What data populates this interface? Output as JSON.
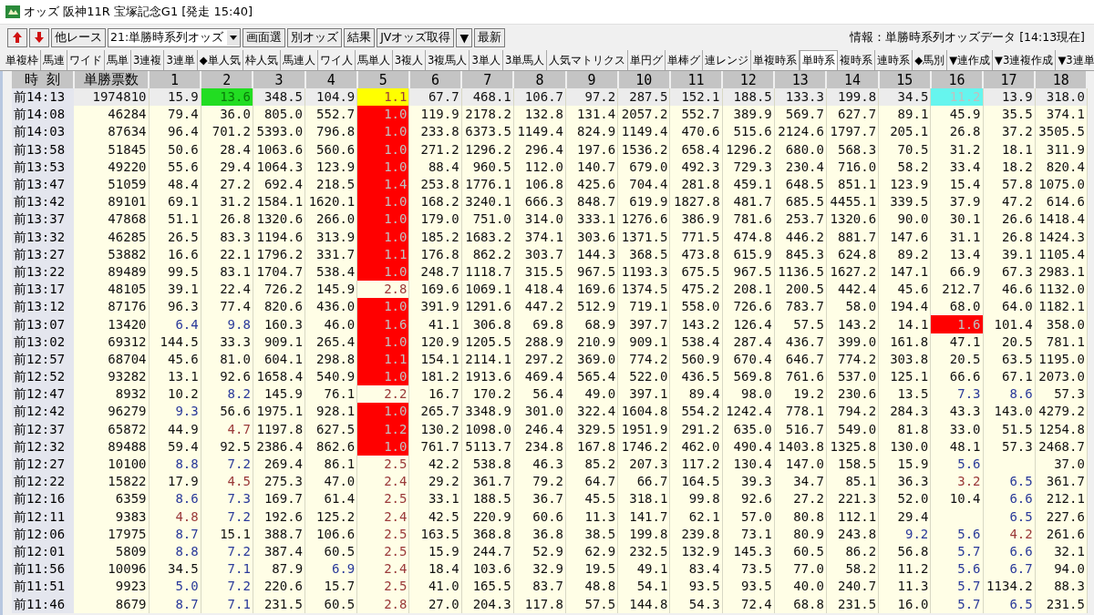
{
  "window": {
    "title": "オッズ 阪神11R 宝塚記念G1 [発走 15:40]"
  },
  "toolbar": {
    "buttons": [
      {
        "kind": "up"
      },
      {
        "kind": "down"
      },
      {
        "kind": "text",
        "label": "他レース"
      }
    ],
    "select": "21:単勝時系列オッズ",
    "actions": [
      "画面選",
      "別オッズ",
      "結果",
      "JVオッズ取得",
      "▼",
      "最新"
    ],
    "info": "情報：単勝時系列オッズデータ [14:13現在]"
  },
  "tabs": [
    {
      "label": "単複枠",
      "selected": false
    },
    {
      "label": "馬連",
      "selected": false
    },
    {
      "label": "ワイド",
      "selected": false
    },
    {
      "label": "馬単",
      "selected": false
    },
    {
      "label": "3連複",
      "selected": false
    },
    {
      "label": "3連単",
      "selected": false
    },
    {
      "label": "◆単人気",
      "selected": false
    },
    {
      "label": "枠人気",
      "selected": false
    },
    {
      "label": "馬連人",
      "selected": false
    },
    {
      "label": "ワイ人",
      "selected": false
    },
    {
      "label": "馬単人",
      "selected": false
    },
    {
      "label": "3複人",
      "selected": false
    },
    {
      "label": "3複馬人",
      "selected": false
    },
    {
      "label": "3単人",
      "selected": false
    },
    {
      "label": "3単馬人",
      "selected": false
    },
    {
      "label": "人気マトリクス",
      "selected": false
    },
    {
      "label": "単円グ",
      "selected": false
    },
    {
      "label": "単棒グ",
      "selected": false
    },
    {
      "label": "連レンジ",
      "selected": false
    },
    {
      "label": "単複時系",
      "selected": false
    },
    {
      "label": "単時系",
      "selected": true
    },
    {
      "label": "複時系",
      "selected": false
    },
    {
      "label": "連時系",
      "selected": false
    },
    {
      "label": "◆馬別",
      "selected": false
    },
    {
      "label": "▼連作成",
      "selected": false
    },
    {
      "label": "▼3連複作成",
      "selected": false
    },
    {
      "label": "▼3連単",
      "selected": false
    }
  ],
  "table": {
    "columns": [
      "時 刻",
      "単勝票数",
      "1",
      "2",
      "3",
      "4",
      "5",
      "6",
      "7",
      "8",
      "9",
      "10",
      "11",
      "12",
      "13",
      "14",
      "15",
      "16",
      "17",
      "18"
    ],
    "rows": [
      {
        "time": "前14:13",
        "votes": "1974810",
        "current": true,
        "odds": [
          "15.9",
          {
            "text": "13.6",
            "color": "#22dd22",
            "kind": "green"
          },
          "348.5",
          "104.9",
          {
            "text": "1.1",
            "color": "#ffff00",
            "kind": "brown"
          },
          "67.7",
          "468.1",
          "106.7",
          "97.2",
          "287.5",
          "152.1",
          "188.5",
          "133.3",
          "199.8",
          "34.5",
          {
            "text": "11.2",
            "color": "#66f5ee",
            "kind": "grey"
          },
          "13.9",
          "318.0"
        ]
      },
      {
        "time": "前14:08",
        "votes": "46284",
        "current": false,
        "odds": [
          "79.4",
          "36.0",
          "805.0",
          "552.7",
          {
            "text": "1.0",
            "color": "#ff0000",
            "kind": "grey"
          },
          "119.9",
          "2178.2",
          "132.8",
          "131.4",
          "2057.2",
          "552.7",
          "389.9",
          "569.7",
          "627.7",
          "89.1",
          "45.9",
          "35.5",
          "374.1"
        ]
      },
      {
        "time": "前14:03",
        "votes": "87634",
        "current": false,
        "odds": [
          "96.4",
          "701.2",
          "5393.0",
          "796.8",
          {
            "text": "1.0",
            "color": "#ff0000",
            "kind": "grey"
          },
          "233.8",
          "6373.5",
          "1149.4",
          "824.9",
          "1149.4",
          "470.6",
          "515.6",
          "2124.6",
          "1797.7",
          "205.1",
          "26.8",
          "37.2",
          "3505.5"
        ]
      },
      {
        "time": "前13:58",
        "votes": "51845",
        "current": false,
        "odds": [
          "50.6",
          "28.4",
          "1063.6",
          "560.6",
          {
            "text": "1.0",
            "color": "#ff0000",
            "kind": "grey"
          },
          "271.2",
          "1296.2",
          "296.4",
          "197.6",
          "1536.2",
          "658.4",
          "1296.2",
          "680.0",
          "568.3",
          "70.5",
          "31.2",
          "18.1",
          "311.9"
        ]
      },
      {
        "time": "前13:53",
        "votes": "49220",
        "current": false,
        "odds": [
          "55.6",
          "29.4",
          "1064.3",
          "123.9",
          {
            "text": "1.0",
            "color": "#ff0000",
            "kind": "grey"
          },
          "88.4",
          "960.5",
          "112.0",
          "140.7",
          "679.0",
          "492.3",
          "729.3",
          "230.4",
          "716.0",
          "58.2",
          "33.4",
          "18.2",
          "820.4"
        ]
      },
      {
        "time": "前13:47",
        "votes": "51059",
        "current": false,
        "odds": [
          "48.4",
          "27.2",
          "692.4",
          "218.5",
          {
            "text": "1.4",
            "color": "#ff0000",
            "kind": "grey"
          },
          "253.8",
          "1776.1",
          "106.8",
          "425.6",
          "704.4",
          "281.8",
          "459.1",
          "648.5",
          "851.1",
          "123.9",
          "15.4",
          "57.8",
          "1075.0"
        ]
      },
      {
        "time": "前13:42",
        "votes": "89101",
        "current": false,
        "odds": [
          "69.1",
          "31.2",
          "1584.1",
          "1620.1",
          {
            "text": "1.0",
            "color": "#ff0000",
            "kind": "grey"
          },
          "168.2",
          "3240.1",
          "666.3",
          "848.7",
          "619.9",
          "1827.8",
          "481.7",
          "685.5",
          "4455.1",
          "339.5",
          "37.9",
          "47.2",
          "614.6"
        ]
      },
      {
        "time": "前13:37",
        "votes": "47868",
        "current": false,
        "odds": [
          "51.1",
          "26.8",
          "1320.6",
          "266.0",
          {
            "text": "1.0",
            "color": "#ff0000",
            "kind": "grey"
          },
          "179.0",
          "751.0",
          "314.0",
          "333.1",
          "1276.6",
          "386.9",
          "781.6",
          "253.7",
          "1320.6",
          "90.0",
          "30.1",
          "26.6",
          "1418.4"
        ]
      },
      {
        "time": "前13:32",
        "votes": "46285",
        "current": false,
        "odds": [
          "26.5",
          "83.3",
          "1194.6",
          "313.9",
          {
            "text": "1.0",
            "color": "#ff0000",
            "kind": "grey"
          },
          "185.2",
          "1683.2",
          "374.1",
          "303.6",
          "1371.5",
          "771.5",
          "474.8",
          "446.2",
          "881.7",
          "147.6",
          "31.1",
          "26.8",
          "1424.3"
        ]
      },
      {
        "time": "前13:27",
        "votes": "53882",
        "current": false,
        "odds": [
          "16.6",
          "22.1",
          "1796.2",
          "331.7",
          {
            "text": "1.1",
            "color": "#ff0000",
            "kind": "grey"
          },
          "176.8",
          "862.2",
          "303.7",
          "144.3",
          "368.5",
          "473.8",
          "615.9",
          "845.3",
          "624.8",
          "89.2",
          "13.4",
          "39.1",
          "1105.4"
        ]
      },
      {
        "time": "前13:22",
        "votes": "89489",
        "current": false,
        "odds": [
          "99.5",
          "83.1",
          "1704.7",
          "538.4",
          {
            "text": "1.0",
            "color": "#ff0000",
            "kind": "grey"
          },
          "248.7",
          "1118.7",
          "315.5",
          "967.5",
          "1193.3",
          "675.5",
          "967.5",
          "1136.5",
          "1627.2",
          "147.1",
          "66.9",
          "67.3",
          "2983.1"
        ]
      },
      {
        "time": "前13:17",
        "votes": "48105",
        "current": false,
        "odds": [
          "39.1",
          "22.4",
          "726.2",
          "145.9",
          {
            "text": "2.8",
            "kind": "brown"
          },
          "169.6",
          "1069.1",
          "418.4",
          "169.6",
          "1374.5",
          "475.2",
          "208.1",
          "200.5",
          "442.4",
          "45.6",
          "212.7",
          "46.6",
          "1132.0"
        ]
      },
      {
        "time": "前13:12",
        "votes": "87176",
        "current": false,
        "odds": [
          "96.3",
          "77.4",
          "820.6",
          "436.0",
          {
            "text": "1.0",
            "color": "#ff0000",
            "kind": "grey"
          },
          "391.9",
          "1291.6",
          "447.2",
          "512.9",
          "719.1",
          "558.0",
          "726.6",
          "783.7",
          "58.0",
          "194.4",
          "68.0",
          "64.0",
          "1182.1"
        ]
      },
      {
        "time": "前13:07",
        "votes": "13420",
        "current": false,
        "odds": [
          {
            "text": "6.4",
            "kind": "navy"
          },
          {
            "text": "9.8",
            "kind": "navy"
          },
          "160.3",
          "46.0",
          {
            "text": "1.6",
            "color": "#ff0000",
            "kind": "grey"
          },
          "41.1",
          "306.8",
          "69.8",
          "68.9",
          "397.7",
          "143.2",
          "126.4",
          "57.5",
          "143.2",
          "14.1",
          {
            "text": "1.6",
            "color": "#ff0000",
            "kind": "grey"
          },
          "101.4",
          "358.0"
        ]
      },
      {
        "time": "前13:02",
        "votes": "69312",
        "current": false,
        "odds": [
          "144.5",
          "33.3",
          "909.1",
          "265.4",
          {
            "text": "1.0",
            "color": "#ff0000",
            "kind": "grey"
          },
          "120.9",
          "1205.5",
          "288.9",
          "210.9",
          "909.1",
          "538.4",
          "287.4",
          "436.7",
          "399.0",
          "161.8",
          "47.1",
          "20.5",
          "781.1"
        ]
      },
      {
        "time": "前12:57",
        "votes": "68704",
        "current": false,
        "odds": [
          "45.6",
          "81.0",
          "604.1",
          "298.8",
          {
            "text": "1.1",
            "color": "#ff0000",
            "kind": "grey"
          },
          "154.1",
          "2114.1",
          "297.2",
          "369.0",
          "774.2",
          "560.9",
          "670.4",
          "646.7",
          "774.2",
          "303.8",
          "20.5",
          "63.5",
          "1195.0"
        ]
      },
      {
        "time": "前12:52",
        "votes": "93282",
        "current": false,
        "odds": [
          "13.1",
          "92.6",
          "1658.4",
          "540.9",
          {
            "text": "1.0",
            "color": "#ff0000",
            "kind": "grey"
          },
          "181.2",
          "1913.6",
          "469.4",
          "565.4",
          "522.0",
          "436.5",
          "569.8",
          "761.6",
          "537.0",
          "125.1",
          "66.6",
          "67.1",
          "2073.0"
        ]
      },
      {
        "time": "前12:47",
        "votes": "8932",
        "current": false,
        "odds": [
          "10.2",
          {
            "text": "8.2",
            "kind": "navy"
          },
          "145.9",
          "76.1",
          {
            "text": "2.2",
            "kind": "brown"
          },
          "16.7",
          "170.2",
          "56.4",
          "49.0",
          "397.1",
          "89.4",
          "98.0",
          "19.2",
          "230.6",
          "13.5",
          {
            "text": "7.3",
            "kind": "navy"
          },
          {
            "text": "8.6",
            "kind": "navy"
          },
          "57.3"
        ]
      },
      {
        "time": "前12:42",
        "votes": "96279",
        "current": false,
        "odds": [
          {
            "text": "9.3",
            "kind": "navy"
          },
          "56.6",
          "1975.1",
          "928.1",
          {
            "text": "1.0",
            "color": "#ff0000",
            "kind": "grey"
          },
          "265.7",
          "3348.9",
          "301.0",
          "322.4",
          "1604.8",
          "554.2",
          "1242.4",
          "778.1",
          "794.2",
          "284.3",
          "43.3",
          "143.0",
          "4279.2"
        ]
      },
      {
        "time": "前12:37",
        "votes": "65872",
        "current": false,
        "odds": [
          "44.9",
          {
            "text": "4.7",
            "kind": "brown"
          },
          "1197.8",
          "627.5",
          {
            "text": "1.2",
            "color": "#ff0000",
            "kind": "grey"
          },
          "130.2",
          "1098.0",
          "246.4",
          "329.5",
          "1951.9",
          "291.2",
          "635.0",
          "516.7",
          "549.0",
          "81.8",
          "33.0",
          "51.5",
          "1254.8"
        ]
      },
      {
        "time": "前12:32",
        "votes": "89488",
        "current": false,
        "odds": [
          "59.4",
          "92.5",
          "2386.4",
          "862.6",
          {
            "text": "1.0",
            "color": "#ff0000",
            "kind": "grey"
          },
          "761.7",
          "5113.7",
          "234.8",
          "167.8",
          "1746.2",
          "462.0",
          "490.4",
          "1403.8",
          "1325.8",
          "130.0",
          "48.1",
          "57.3",
          "2468.7"
        ]
      },
      {
        "time": "前12:27",
        "votes": "10100",
        "current": false,
        "odds": [
          {
            "text": "8.8",
            "kind": "navy"
          },
          {
            "text": "7.2",
            "kind": "navy"
          },
          "269.4",
          "86.1",
          {
            "text": "2.5",
            "kind": "brown"
          },
          "42.2",
          "538.8",
          "46.3",
          "85.2",
          "207.3",
          "117.2",
          "130.4",
          "147.0",
          "158.5",
          "15.9",
          {
            "text": "5.6",
            "kind": "navy"
          },
          {
            "kind": "blank"
          },
          "37.0"
        ]
      },
      {
        "time": "前12:22",
        "votes": "15822",
        "current": false,
        "odds": [
          "17.9",
          {
            "text": "4.5",
            "kind": "brown"
          },
          "275.3",
          "47.0",
          {
            "text": "2.4",
            "kind": "brown"
          },
          "29.2",
          "361.7",
          "79.2",
          "64.7",
          "66.7",
          "164.5",
          "39.3",
          "34.7",
          "85.1",
          "36.3",
          {
            "text": "3.2",
            "kind": "brown"
          },
          {
            "text": "6.5",
            "kind": "navy"
          },
          "361.7"
        ]
      },
      {
        "time": "前12:16",
        "votes": "6359",
        "current": false,
        "odds": [
          {
            "text": "8.6",
            "kind": "navy"
          },
          {
            "text": "7.3",
            "kind": "navy"
          },
          "169.7",
          "61.4",
          {
            "text": "2.5",
            "kind": "brown"
          },
          "33.1",
          "188.5",
          "36.7",
          "45.5",
          "318.1",
          "99.8",
          "92.6",
          "27.2",
          "221.3",
          "52.0",
          "10.4",
          {
            "text": "6.6",
            "kind": "navy"
          },
          "212.1"
        ]
      },
      {
        "time": "前12:11",
        "votes": "9383",
        "current": false,
        "odds": [
          {
            "text": "4.8",
            "kind": "brown"
          },
          {
            "text": "7.2",
            "kind": "navy"
          },
          "192.6",
          "125.2",
          {
            "text": "2.4",
            "kind": "brown"
          },
          "42.5",
          "220.9",
          "60.6",
          "11.3",
          "141.7",
          "62.1",
          "57.0",
          "80.8",
          "112.1",
          "29.4",
          {
            "kind": "blank"
          },
          {
            "text": "6.5",
            "kind": "navy"
          },
          "227.6"
        ]
      },
      {
        "time": "前12:06",
        "votes": "17975",
        "current": false,
        "odds": [
          {
            "text": "8.7",
            "kind": "navy"
          },
          "15.1",
          "388.7",
          "106.6",
          {
            "text": "2.5",
            "kind": "brown"
          },
          "163.5",
          "368.8",
          "36.8",
          "38.5",
          "199.8",
          "239.8",
          "73.1",
          "80.9",
          "243.8",
          {
            "text": "9.2",
            "kind": "navy"
          },
          {
            "text": "5.6",
            "kind": "navy"
          },
          {
            "text": "4.2",
            "kind": "brown"
          },
          "261.6"
        ]
      },
      {
        "time": "前12:01",
        "votes": "5809",
        "current": false,
        "odds": [
          {
            "text": "8.8",
            "kind": "navy"
          },
          {
            "text": "7.2",
            "kind": "navy"
          },
          "387.4",
          "60.5",
          {
            "text": "2.5",
            "kind": "brown"
          },
          "15.9",
          "244.7",
          "52.9",
          "62.9",
          "232.5",
          "132.9",
          "145.3",
          "60.5",
          "86.2",
          "56.8",
          {
            "text": "5.7",
            "kind": "navy"
          },
          {
            "text": "6.6",
            "kind": "navy"
          },
          "32.1"
        ]
      },
      {
        "time": "前11:56",
        "votes": "10096",
        "current": false,
        "odds": [
          "34.5",
          {
            "text": "7.1",
            "kind": "navy"
          },
          "87.9",
          {
            "text": "6.9",
            "kind": "navy"
          },
          {
            "text": "2.4",
            "kind": "brown"
          },
          "18.4",
          "103.6",
          "32.9",
          "19.5",
          "49.1",
          "83.4",
          "73.5",
          "77.0",
          "58.2",
          "11.2",
          {
            "text": "5.6",
            "kind": "navy"
          },
          {
            "text": "6.7",
            "kind": "navy"
          },
          "94.0"
        ]
      },
      {
        "time": "前11:51",
        "votes": "9923",
        "current": false,
        "odds": [
          {
            "text": "5.0",
            "kind": "navy"
          },
          {
            "text": "7.2",
            "kind": "navy"
          },
          "220.6",
          "15.7",
          {
            "text": "2.5",
            "kind": "brown"
          },
          "41.0",
          "165.5",
          "83.7",
          "48.8",
          "54.1",
          "93.5",
          "93.5",
          "40.0",
          "240.7",
          "11.3",
          {
            "text": "5.7",
            "kind": "navy"
          },
          "1134.2",
          "88.3"
        ]
      },
      {
        "time": "前11:46",
        "votes": "8679",
        "current": false,
        "odds": [
          {
            "text": "8.7",
            "kind": "navy"
          },
          {
            "text": "7.1",
            "kind": "navy"
          },
          "231.5",
          "60.5",
          {
            "text": "2.8",
            "kind": "brown"
          },
          "27.0",
          "204.3",
          "117.8",
          "57.5",
          "144.8",
          "54.3",
          "72.4",
          "68.8",
          "231.5",
          "16.0",
          {
            "text": "5.7",
            "kind": "navy"
          },
          {
            "text": "6.5",
            "kind": "navy"
          },
          "231.5"
        ]
      }
    ]
  }
}
